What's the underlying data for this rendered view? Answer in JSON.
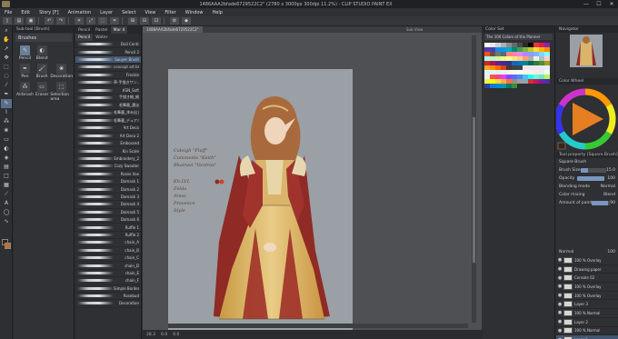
{
  "window": {
    "title": "1486AAA2bfade6729522C2\" (2780 x 3000px 300dpi 11.2%) - CLIP STUDIO PAINT EX",
    "minimize": "—",
    "maximize": "☐",
    "close": "✕"
  },
  "menu": [
    "File",
    "Edit",
    "Story [F]",
    "Animation",
    "Layer",
    "Select",
    "View",
    "Filter",
    "Window",
    "Help"
  ],
  "subtool_panel": {
    "header": "Sub tool [Brush]",
    "group": "Brushes",
    "items": [
      {
        "label": "Pencil",
        "icon": "pencil-icon",
        "glyph": "✎"
      },
      {
        "label": "Blend",
        "icon": "blend-icon",
        "glyph": "◐"
      },
      {
        "label": "Pen",
        "icon": "pen-icon",
        "glyph": "✒"
      },
      {
        "label": "Brush",
        "icon": "brush-icon",
        "glyph": "🖌"
      },
      {
        "label": "Decoration",
        "icon": "decoration-icon",
        "glyph": "❀"
      },
      {
        "label": "Airbrush",
        "icon": "airbrush-icon",
        "glyph": "⁂"
      },
      {
        "label": "Eraser",
        "icon": "eraser-icon",
        "glyph": "▭"
      },
      {
        "label": "Selection area",
        "icon": "selection-area-icon",
        "glyph": "⬚"
      }
    ]
  },
  "brush_panel": {
    "tabs": [
      "Pencil",
      "Pastel",
      "Mar 4"
    ],
    "subtabs": [
      "Pencil",
      "Water"
    ],
    "brushes": [
      "Dull Contr",
      "Pencil 2",
      "Sauyer Brush",
      "concept art brus",
      "Freckle",
      "草-手描きサン…",
      "KSN_Soft",
      "手描き細_細",
      "毛筆墨_濃淡",
      "毛筆墨_滲み出し",
      "毛筆墨_デュアル",
      "Art Deco",
      "Art Deco 2",
      "Embossed",
      "Kin Scale",
      "Embroidery_2",
      "Cozy Sweater",
      "Roses line",
      "Damask 1",
      "Damask 2",
      "Damask 3",
      "Damask 4",
      "Damask 5",
      "Damask 6",
      "Ruffle 1",
      "Ruffle 2",
      "chain_A",
      "chain_B",
      "chain_C",
      "chain_D",
      "chain_E",
      "chain_F",
      "Simple Border",
      "Rosebud",
      "Decoration"
    ],
    "selected_index": 2
  },
  "document": {
    "tab": "1486AAA2bfade6729522C2\"",
    "sub_view": "Sub View"
  },
  "handwriting": [
    "Caleigh \"Fluff\"",
    "Comments \"Keith\"",
    "Bhairavi \"Vardros\"",
    "Kh.LVL",
    "Zelda",
    "dress",
    "Provence",
    "Style"
  ],
  "status": {
    "zoom": "28.3",
    "coords": "0.0",
    "angle": "0.0"
  },
  "color_set": {
    "header": "Color Set",
    "name": "The 100 Colors of the Planner",
    "colors": [
      "#ffffff",
      "#e8e8e8",
      "#cfcfcf",
      "#b0b0b0",
      "#8c8c8c",
      "#6a6a6a",
      "#4a4a4a",
      "#2a2a2a",
      "#000000",
      "#e53935",
      "#d81b60",
      "#8e24aa",
      "#5e35b1",
      "#3949ab",
      "#1e88e5",
      "#039be5",
      "#00acc1",
      "#00897b",
      "#43a047",
      "#7cb342",
      "#c0ca33",
      "#fdd835",
      "#ffb300",
      "#fb8c00",
      "#f4511e",
      "#6d4c41",
      "#757575",
      "#546e7a",
      "#ff8a80",
      "#ff80ab",
      "#ea80fc",
      "#b388ff",
      "#8c9eff",
      "#82b1ff",
      "#80d8ff",
      "#84ffff",
      "#a7ffeb",
      "#b9f6ca",
      "#ccff90",
      "#f4ff81",
      "#ffff8d",
      "#ffe57f",
      "#ffd180",
      "#ff9e80",
      "#bcaaa4",
      "#eeeeee",
      "#b0bec5",
      "#ffcdd2",
      "#c62828",
      "#ad1457",
      "#6a1b9a",
      "#4527a0",
      "#283593",
      "#1565c0",
      "#0277bd",
      "#00838f",
      "#00695c",
      "#2e7d32",
      "#558b2f",
      "#9e9d24",
      "#f9a825",
      "#ff8f00",
      "#ef6c00",
      "#d84315",
      "#4e342e",
      "#424242",
      "#37474f",
      "#fce4ec",
      "#f3e5f5",
      "#ede7f6",
      "#e8eaf6",
      "#e3f2fd",
      "#e1f5fe",
      "#e0f7fa",
      "#e0f2f1",
      "#e8f5e9",
      "#f1f8e9",
      "#f9fbe7",
      "#fffde7",
      "#fff8e1",
      "#fff3e0",
      "#fbe9e7",
      "#efebe9",
      "#fafafa",
      "#eceff1",
      "#ff5252",
      "#ff4081",
      "#e040fb",
      "#7c4dff",
      "#536dfe",
      "#448aff",
      "#40c4ff",
      "#18ffff",
      "#64ffda",
      "#69f0ae",
      "#b2ff59",
      "#eeff41",
      "#ffff00",
      "#ffd740",
      "#ffab40",
      "#ff6e40",
      "#a1887f",
      "#9e9e9e",
      "#90a4ae",
      "#d32f2f",
      "#c2185b",
      "#7b1fa2",
      "#512da8",
      "#303f9f",
      "#1976d2",
      "#0288d1",
      "#0097a7",
      "#00796b",
      "#388e3c"
    ]
  },
  "navigator": {
    "header": "Navigator"
  },
  "color_wheel": {
    "header": "Color Wheel",
    "hue_color": "#e67e22"
  },
  "tool_property": {
    "header": "Tool property [Square Brush]",
    "brush_name": "Square Brush",
    "rows": [
      {
        "label": "Brush Size",
        "value": "15.0",
        "level": 0.3
      },
      {
        "label": "Opacity",
        "value": "100",
        "level": 1.0
      },
      {
        "label": "Blending mode",
        "value": "Normal",
        "level": null
      },
      {
        "label": "Color mixing",
        "value": "Blend",
        "level": null
      },
      {
        "label": "Amount of paint",
        "value": "90",
        "level": 0.9
      }
    ]
  },
  "layers": {
    "blend_mode": "Normal",
    "opacity": "100",
    "items": [
      {
        "name": "100 % Overlay",
        "sel": false
      },
      {
        "name": "Drawing paper",
        "sel": false
      },
      {
        "name": "Console 02",
        "sel": false
      },
      {
        "name": "100 % Overlay",
        "sel": false
      },
      {
        "name": "100 % Overlay",
        "sel": false
      },
      {
        "name": "Layer 3",
        "sel": false
      },
      {
        "name": "100 % Normal",
        "sel": false
      },
      {
        "name": "Layer 2",
        "sel": false
      },
      {
        "name": "100 % Normal",
        "sel": false
      },
      {
        "name": "Layer 1",
        "sel": true
      },
      {
        "name": "Paper",
        "sel": false
      }
    ]
  }
}
